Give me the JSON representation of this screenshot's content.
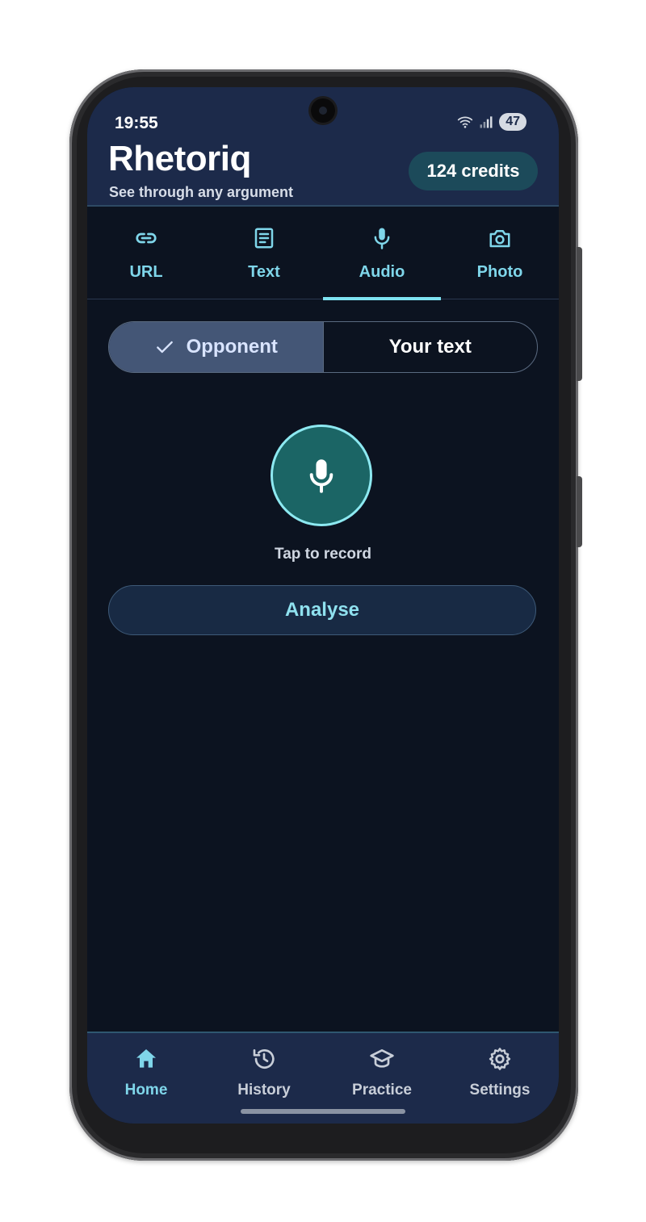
{
  "status_bar": {
    "time": "19:55",
    "battery": "47"
  },
  "header": {
    "title": "Rhetoriq",
    "subtitle": "See through any argument",
    "credits": "124 credits"
  },
  "tabs": [
    {
      "label": "URL",
      "icon": "link-icon"
    },
    {
      "label": "Text",
      "icon": "document-icon"
    },
    {
      "label": "Audio",
      "icon": "microphone-icon",
      "active": true
    },
    {
      "label": "Photo",
      "icon": "camera-icon"
    }
  ],
  "segment": {
    "opponent": "Opponent",
    "your_text": "Your text"
  },
  "record": {
    "label": "Tap to record"
  },
  "analyse": {
    "label": "Analyse"
  },
  "bottom_nav": [
    {
      "label": "Home",
      "icon": "home-icon",
      "active": true
    },
    {
      "label": "History",
      "icon": "history-icon"
    },
    {
      "label": "Practice",
      "icon": "graduation-cap-icon"
    },
    {
      "label": "Settings",
      "icon": "gear-icon"
    }
  ],
  "colors": {
    "accent": "#7fd6ea",
    "header_bg": "#1c2a4a",
    "screen_bg": "#0c1320",
    "record_fill": "#1b6565"
  }
}
